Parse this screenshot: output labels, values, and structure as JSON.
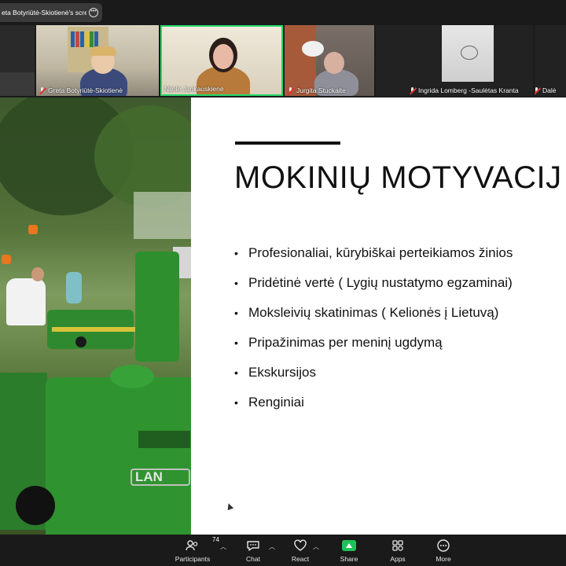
{
  "share_pill": {
    "text": "eta Botyriūtė-Skiotienė's scree",
    "more_icon": "more-horizontal-icon"
  },
  "participants": [
    {
      "name": ""
    },
    {
      "name": "Greta Botyriūtė-Skiotienė",
      "muted": true
    },
    {
      "name": "Nijolė Jankauskienė",
      "muted": false,
      "speaking": true
    },
    {
      "name": "Jurgita Stuckaite",
      "muted": true
    },
    {
      "name": "Ingrida Lomberg -Saulėtas Kranta",
      "muted": true
    },
    {
      "name": "Dalė",
      "muted": true
    }
  ],
  "slide": {
    "title": "MOKINIŲ MOTYVACIJ",
    "bullets": [
      "Profesionaliai, kūrybiškai perteikiamos žinios",
      "Pridėtinė vertė ( Lygių nustatymo egzaminai)",
      "Moksleivių skatinimas ( Kelionės į Lietuvą)",
      "Pripažinimas per meninį ugdymą",
      "Ekskursijos",
      "Renginiai"
    ],
    "photo_badge": "LAN"
  },
  "toolbar": {
    "participants_label": "Participants",
    "participants_count": "74",
    "chat_label": "Chat",
    "react_label": "React",
    "share_label": "Share",
    "apps_label": "Apps",
    "more_label": "More"
  },
  "colors": {
    "active_speaker": "#23d96b",
    "share_green": "#1fc25a",
    "muted_red": "#e03030",
    "tractor_green": "#2f8a2f"
  }
}
